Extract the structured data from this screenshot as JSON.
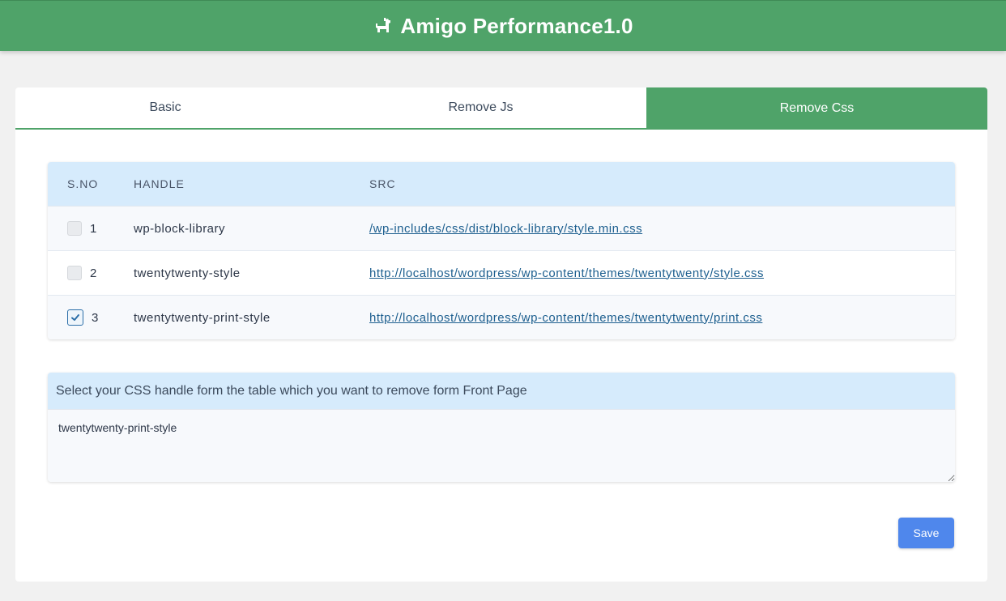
{
  "header": {
    "title": "Amigo Performance1.0",
    "icon": "dog-icon",
    "color": "#4fa369"
  },
  "tabs": [
    {
      "label": "Basic",
      "active": false
    },
    {
      "label": "Remove Js",
      "active": false
    },
    {
      "label": "Remove Css",
      "active": true
    }
  ],
  "table": {
    "headers": [
      "S.NO",
      "HANDLE",
      "SRC"
    ],
    "rows": [
      {
        "sno": "1",
        "handle": "wp-block-library",
        "src": "/wp-includes/css/dist/block-library/style.min.css",
        "checked": false
      },
      {
        "sno": "2",
        "handle": "twentytwenty-style",
        "src": "http://localhost/wordpress/wp-content/themes/twentytwenty/style.css",
        "checked": false
      },
      {
        "sno": "3",
        "handle": "twentytwenty-print-style",
        "src": "http://localhost/wordpress/wp-content/themes/twentytwenty/print.css",
        "checked": true
      }
    ]
  },
  "input": {
    "label": "Select your CSS handle form the table which you want to remove form Front Page",
    "value": "twentytwenty-print-style"
  },
  "actions": {
    "save_label": "Save",
    "save_color": "#4f87ec"
  }
}
